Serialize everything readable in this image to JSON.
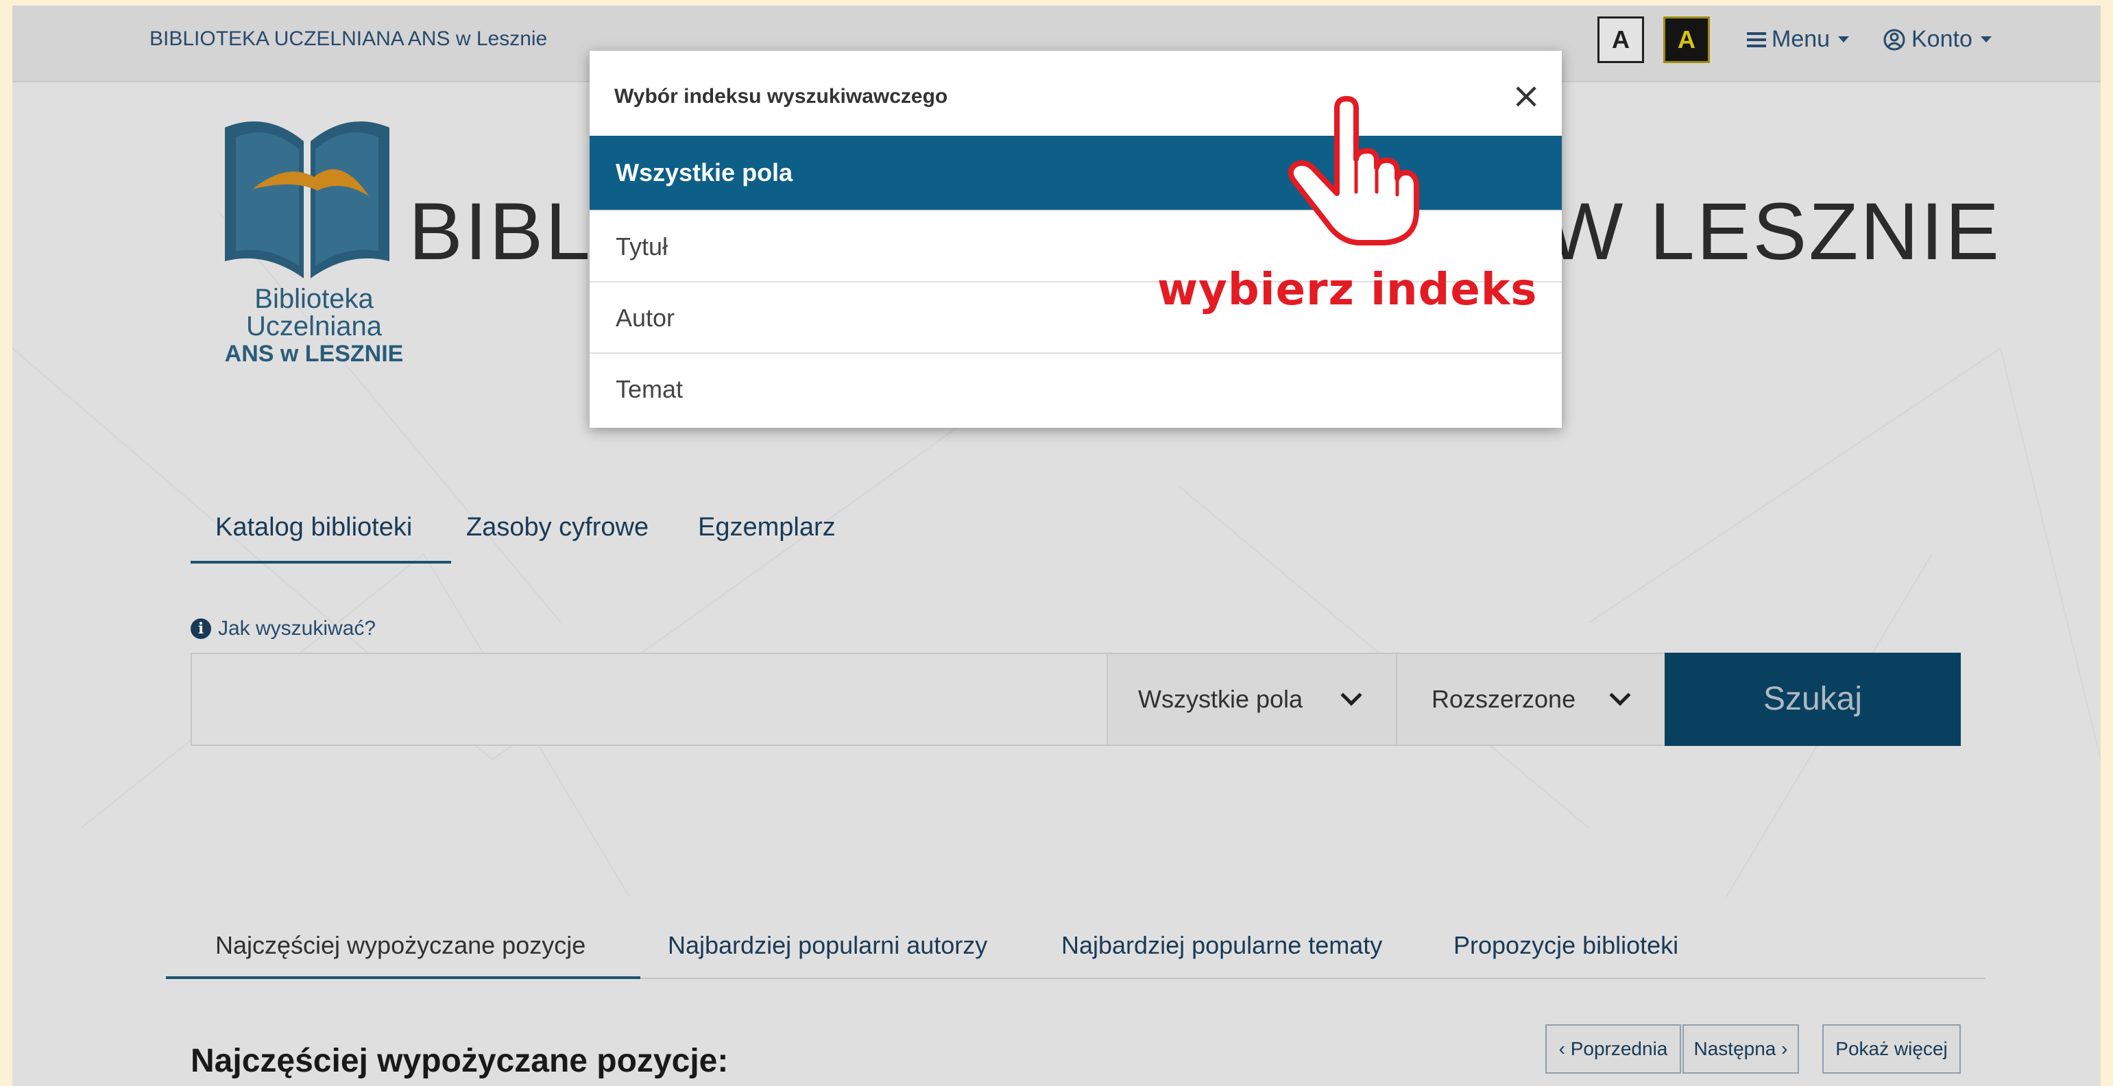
{
  "topbar": {
    "library_name": "BIBLIOTEKA UCZELNIANA  ANS w Lesznie",
    "contrast_normal": "A",
    "contrast_high": "A",
    "menu_label": "Menu",
    "account_label": "Konto"
  },
  "header": {
    "logo_line1": "Biblioteka",
    "logo_line2": "Uczelniana",
    "logo_line3": "ANS w LESZNIE",
    "title_left": "BIBL",
    "title_right": "W LESZNIE"
  },
  "search_tabs": [
    {
      "label": "Katalog biblioteki",
      "active": true
    },
    {
      "label": "Zasoby cyfrowe",
      "active": false
    },
    {
      "label": "Egzemplarz",
      "active": false
    }
  ],
  "search": {
    "howto": "Jak wyszukiwać?",
    "query": "",
    "index_selected": "Wszystkie pola",
    "mode_selected": "Rozszerzone",
    "button": "Szukaj"
  },
  "bottom_tabs": [
    {
      "label": "Najczęściej wypożyczane pozycje",
      "active": true
    },
    {
      "label": "Najbardziej popularni autorzy",
      "active": false
    },
    {
      "label": "Najbardziej popularne tematy",
      "active": false
    },
    {
      "label": "Propozycje biblioteki",
      "active": false
    }
  ],
  "section": {
    "heading": "Najczęściej wypożyczane pozycje:",
    "prev": "‹ Poprzednia",
    "next": "Następna ›",
    "more": "Pokaż więcej"
  },
  "modal": {
    "title": "Wybór indeksu wyszukiwawczego",
    "close": "×",
    "options": [
      {
        "label": "Wszystkie pola",
        "selected": true
      },
      {
        "label": "Tytuł",
        "selected": false
      },
      {
        "label": "Autor",
        "selected": false
      },
      {
        "label": "Temat",
        "selected": false
      }
    ]
  },
  "annotation": {
    "text": "wybierz indeks",
    "color": "#e31b23"
  },
  "colors": {
    "primary": "#0b4465",
    "selected": "#0e5f88",
    "background": "#fcf1d4"
  },
  "icons": {
    "menu": "hamburger-icon",
    "account": "user-circle-icon",
    "info": "info-icon",
    "pointer": "hand-pointer-icon"
  }
}
